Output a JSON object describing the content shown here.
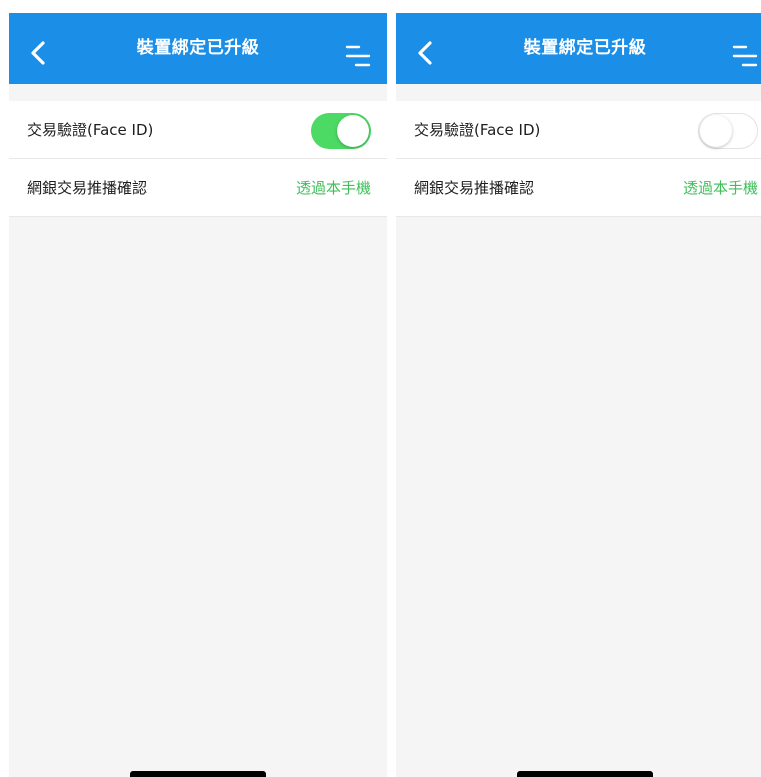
{
  "screens": [
    {
      "nav": {
        "title": "裝置綁定已升級",
        "back_icon": "chevron-left-icon",
        "menu_icon": "menu-lines-icon",
        "color": "#1b8ee8"
      },
      "rows": [
        {
          "label": "交易驗證(Face ID)",
          "toggle_on": true
        },
        {
          "label": "網銀交易推播確認",
          "value": "透過本手機"
        }
      ]
    },
    {
      "nav": {
        "title": "裝置綁定已升級",
        "back_icon": "chevron-left-icon",
        "menu_icon": "menu-lines-icon",
        "color": "#1b8ee8"
      },
      "rows": [
        {
          "label": "交易驗證(Face ID)",
          "toggle_on": false
        },
        {
          "label": "網銀交易推播確認",
          "value": "透過本手機"
        }
      ]
    }
  ],
  "colors": {
    "accent_green": "#3fbf5a",
    "toggle_on": "#4cd964"
  }
}
